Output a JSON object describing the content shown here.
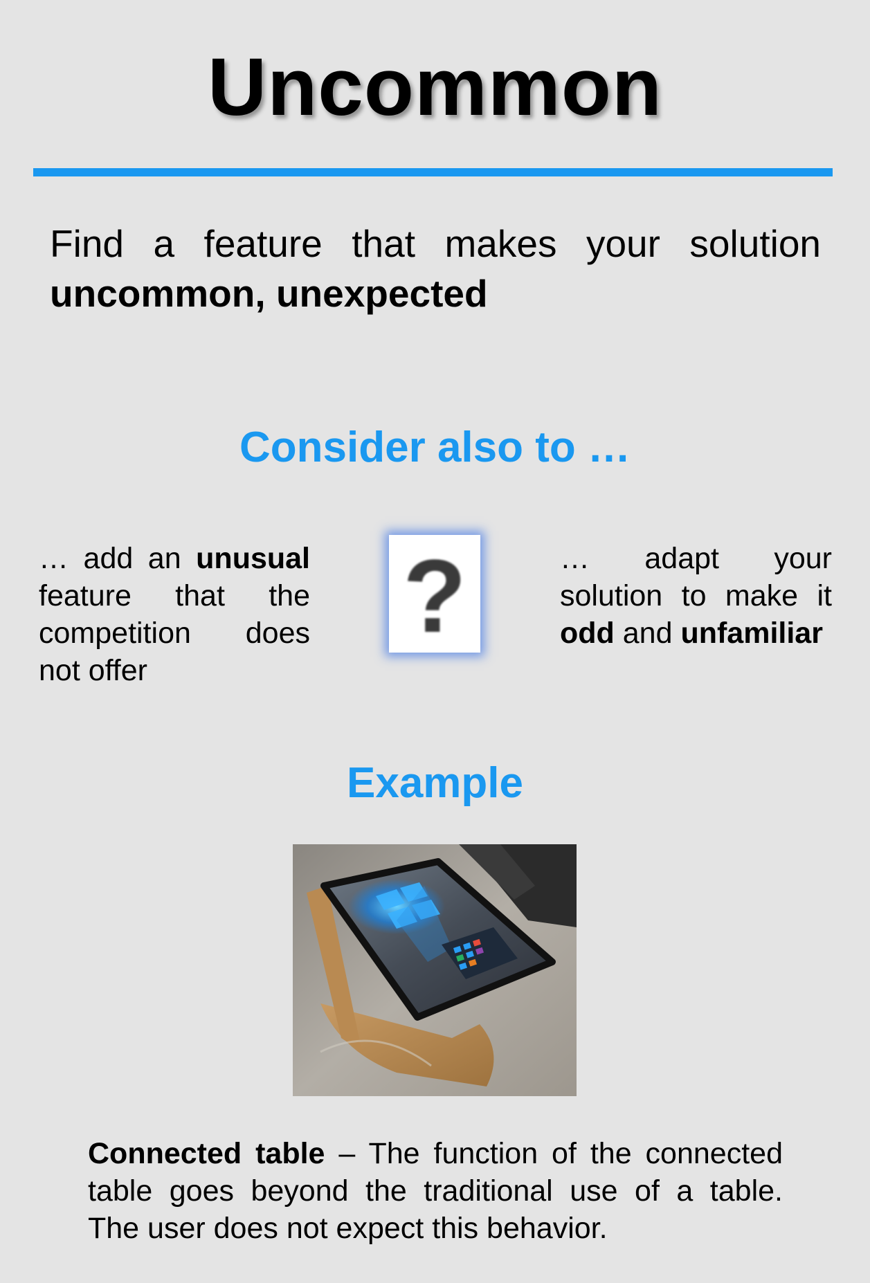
{
  "title": "Uncommon",
  "intro": {
    "line1": "Find a feature that makes your solution",
    "line2_bold": "uncommon, unexpected"
  },
  "consider": {
    "heading": "Consider also to …",
    "left": {
      "pre": "… add an ",
      "bold": "unusual",
      "post": " feature that the competition does not offer"
    },
    "right": {
      "pre": "… adapt your solution to make it ",
      "bold1": "odd",
      "mid": " and ",
      "bold2": "unfamiliar"
    },
    "question_mark": "?"
  },
  "example": {
    "heading": "Example",
    "image_icon": "connected-table-photo",
    "caption_bold": "Connected table",
    "caption_line1_rest": " – The function of the connected",
    "caption_line2": "table goes beyond the traditional use of a table.",
    "caption_line3": "The user does not expect this behavior."
  },
  "colors": {
    "accent": "#1a98f0",
    "background": "#e4e4e4"
  }
}
